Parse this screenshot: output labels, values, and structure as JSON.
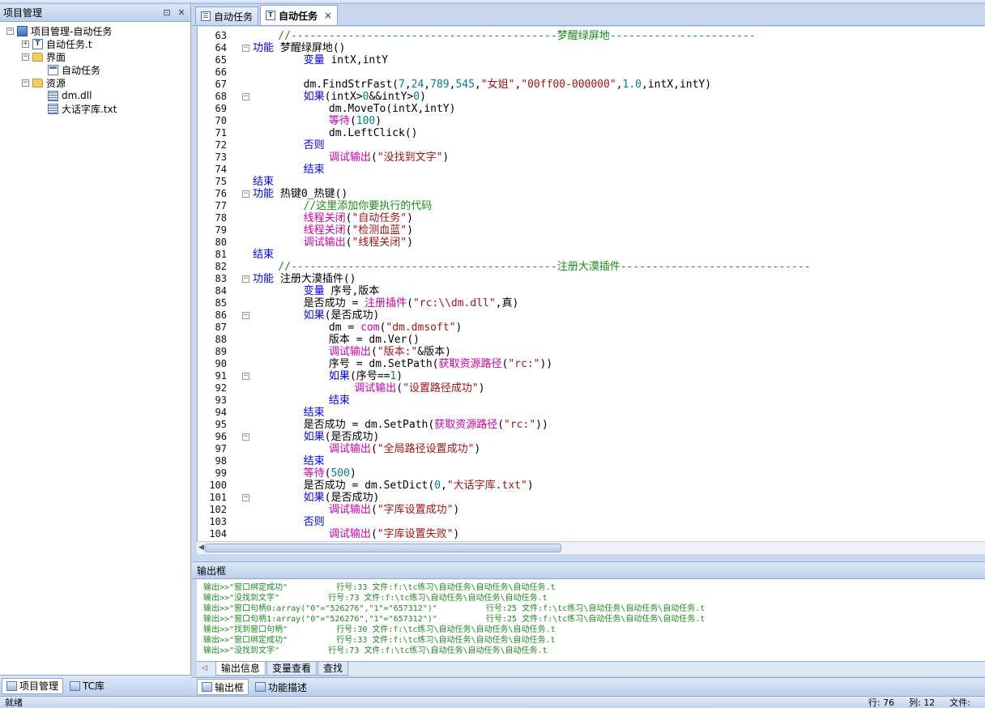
{
  "left_panel": {
    "title": "项目管理",
    "pin_icon": "pin-icon",
    "close_icon": "close-icon",
    "tree": [
      {
        "label": "项目管理-自动任务",
        "level": 0,
        "expander": "⊟",
        "icon": "project"
      },
      {
        "label": "自动任务.t",
        "level": 1,
        "expander": "⊞",
        "icon": "tfile"
      },
      {
        "label": "界面",
        "level": 1,
        "expander": "⊟",
        "icon": "folder"
      },
      {
        "label": "自动任务",
        "level": 2,
        "expander": "",
        "icon": "form"
      },
      {
        "label": "资源",
        "level": 1,
        "expander": "⊟",
        "icon": "folder"
      },
      {
        "label": "dm.dll",
        "level": 2,
        "expander": "",
        "icon": "grid"
      },
      {
        "label": "大话字库.txt",
        "level": 2,
        "expander": "",
        "icon": "grid"
      }
    ],
    "bottom_tabs": [
      "项目管理",
      "TC库"
    ]
  },
  "editor_tabs": [
    {
      "label": "自动任务",
      "active": false
    },
    {
      "label": "自动任务",
      "active": true,
      "close": "×"
    }
  ],
  "code": {
    "first_line": 63,
    "lines": [
      {
        "n": 63,
        "fold": "",
        "segs": [
          [
            "    //------------------------------------------",
            "#1a8a1a"
          ],
          [
            "梦醒绿屏地",
            "#1a8a1a"
          ],
          [
            "-----------------------",
            "#1a8a1a"
          ]
        ]
      },
      {
        "n": 64,
        "fold": "⊟",
        "segs": [
          [
            "功能",
            "#0000ff"
          ],
          [
            " 梦醒绿屏地()",
            "#000000"
          ]
        ]
      },
      {
        "n": 65,
        "fold": "",
        "segs": [
          [
            "        ",
            "#000"
          ],
          [
            "变量",
            "#0000ff"
          ],
          [
            " intX,intY",
            "#000000"
          ]
        ]
      },
      {
        "n": 66,
        "fold": "",
        "segs": [
          [
            "",
            "#000"
          ]
        ]
      },
      {
        "n": 67,
        "fold": "",
        "segs": [
          [
            "        dm.FindStrFast(",
            "#000000"
          ],
          [
            "7",
            "#008080"
          ],
          [
            ",",
            "#000"
          ],
          [
            "24",
            "#008080"
          ],
          [
            ",",
            "#000"
          ],
          [
            "789",
            "#008080"
          ],
          [
            ",",
            "#000"
          ],
          [
            "545",
            "#008080"
          ],
          [
            ",",
            "#000"
          ],
          [
            "\"女姐\"",
            "#a31515"
          ],
          [
            ",",
            "#000"
          ],
          [
            "\"00ff00-000000\"",
            "#a31515"
          ],
          [
            ",",
            "#000"
          ],
          [
            "1.0",
            "#008080"
          ],
          [
            ",intX,intY)",
            "#000000"
          ]
        ]
      },
      {
        "n": 68,
        "fold": "⊟",
        "segs": [
          [
            "        ",
            "#000"
          ],
          [
            "如果",
            "#0000ff"
          ],
          [
            "(intX>",
            "#000000"
          ],
          [
            "0",
            "#008080"
          ],
          [
            "&&intY>",
            "#000000"
          ],
          [
            "0",
            "#008080"
          ],
          [
            ")",
            "#000"
          ]
        ]
      },
      {
        "n": 69,
        "fold": "",
        "segs": [
          [
            "            dm.MoveTo(intX,intY)",
            "#000000"
          ]
        ]
      },
      {
        "n": 70,
        "fold": "",
        "segs": [
          [
            "            ",
            "#000"
          ],
          [
            "等待",
            "#cc00aa"
          ],
          [
            "(",
            "#000"
          ],
          [
            "100",
            "#008080"
          ],
          [
            ")",
            "#000"
          ]
        ]
      },
      {
        "n": 71,
        "fold": "",
        "segs": [
          [
            "            dm.LeftClick()",
            "#000000"
          ]
        ]
      },
      {
        "n": 72,
        "fold": "",
        "segs": [
          [
            "        ",
            "#000"
          ],
          [
            "否则",
            "#0000ff"
          ]
        ]
      },
      {
        "n": 73,
        "fold": "",
        "segs": [
          [
            "            ",
            "#000"
          ],
          [
            "调试输出",
            "#cc00aa"
          ],
          [
            "(",
            "#000"
          ],
          [
            "\"没找到文字\"",
            "#a31515"
          ],
          [
            ")",
            "#000"
          ]
        ]
      },
      {
        "n": 74,
        "fold": "",
        "segs": [
          [
            "        ",
            "#000"
          ],
          [
            "结束",
            "#0000ff"
          ]
        ]
      },
      {
        "n": 75,
        "fold": "",
        "segs": [
          [
            "结束",
            "#0000ff"
          ]
        ]
      },
      {
        "n": 76,
        "fold": "⊟",
        "segs": [
          [
            "功能",
            "#0000ff"
          ],
          [
            " 热键0_热键()",
            "#000000"
          ]
        ]
      },
      {
        "n": 77,
        "fold": "",
        "segs": [
          [
            "        //这里添加你要执行的代码",
            "#1a8a1a"
          ]
        ]
      },
      {
        "n": 78,
        "fold": "",
        "segs": [
          [
            "        ",
            "#000"
          ],
          [
            "线程关闭",
            "#cc00aa"
          ],
          [
            "(",
            "#000"
          ],
          [
            "\"自动任务\"",
            "#a31515"
          ],
          [
            ")",
            "#000"
          ]
        ]
      },
      {
        "n": 79,
        "fold": "",
        "segs": [
          [
            "        ",
            "#000"
          ],
          [
            "线程关闭",
            "#cc00aa"
          ],
          [
            "(",
            "#000"
          ],
          [
            "\"检测血蓝\"",
            "#a31515"
          ],
          [
            ")",
            "#000"
          ]
        ]
      },
      {
        "n": 80,
        "fold": "",
        "segs": [
          [
            "        ",
            "#000"
          ],
          [
            "调试输出",
            "#cc00aa"
          ],
          [
            "(",
            "#000"
          ],
          [
            "\"线程关闭\"",
            "#a31515"
          ],
          [
            ")",
            "#000"
          ]
        ]
      },
      {
        "n": 81,
        "fold": "",
        "segs": [
          [
            "结束",
            "#0000ff"
          ]
        ]
      },
      {
        "n": 82,
        "fold": "",
        "segs": [
          [
            "    //------------------------------------------",
            "#1a8a1a"
          ],
          [
            "注册大漠插件",
            "#1a8a1a"
          ],
          [
            "------------------------------",
            "#1a8a1a"
          ]
        ]
      },
      {
        "n": 83,
        "fold": "⊟",
        "segs": [
          [
            "功能",
            "#0000ff"
          ],
          [
            " 注册大漠插件()",
            "#000000"
          ]
        ]
      },
      {
        "n": 84,
        "fold": "",
        "segs": [
          [
            "        ",
            "#000"
          ],
          [
            "变量",
            "#0000ff"
          ],
          [
            " 序号,版本",
            "#000000"
          ]
        ]
      },
      {
        "n": 85,
        "fold": "",
        "segs": [
          [
            "        是否成功 = ",
            "#000000"
          ],
          [
            "注册插件",
            "#cc00aa"
          ],
          [
            "(",
            "#000"
          ],
          [
            "\"rc:\\\\dm.dll\"",
            "#a31515"
          ],
          [
            ",真)",
            "#000000"
          ]
        ]
      },
      {
        "n": 86,
        "fold": "⊟",
        "segs": [
          [
            "        ",
            "#000"
          ],
          [
            "如果",
            "#0000ff"
          ],
          [
            "(是否成功)",
            "#000000"
          ]
        ]
      },
      {
        "n": 87,
        "fold": "",
        "segs": [
          [
            "            dm = ",
            "#000000"
          ],
          [
            "com",
            "#cc00aa"
          ],
          [
            "(",
            "#000"
          ],
          [
            "\"dm.dmsoft\"",
            "#a31515"
          ],
          [
            ")",
            "#000"
          ]
        ]
      },
      {
        "n": 88,
        "fold": "",
        "segs": [
          [
            "            版本 = dm.Ver()",
            "#000000"
          ]
        ]
      },
      {
        "n": 89,
        "fold": "",
        "segs": [
          [
            "            ",
            "#000"
          ],
          [
            "调试输出",
            "#cc00aa"
          ],
          [
            "(",
            "#000"
          ],
          [
            "\"版本:\"",
            "#a31515"
          ],
          [
            "&版本)",
            "#000000"
          ]
        ]
      },
      {
        "n": 90,
        "fold": "",
        "segs": [
          [
            "            序号 = dm.SetPath(",
            "#000000"
          ],
          [
            "获取资源路径",
            "#cc00aa"
          ],
          [
            "(",
            "#000"
          ],
          [
            "\"rc:\"",
            "#a31515"
          ],
          [
            "))",
            "#000"
          ]
        ]
      },
      {
        "n": 91,
        "fold": "⊟",
        "segs": [
          [
            "            ",
            "#000"
          ],
          [
            "如果",
            "#0000ff"
          ],
          [
            "(序号==",
            "#000000"
          ],
          [
            "1",
            "#008080"
          ],
          [
            ")",
            "#000"
          ]
        ]
      },
      {
        "n": 92,
        "fold": "",
        "segs": [
          [
            "                ",
            "#000"
          ],
          [
            "调试输出",
            "#cc00aa"
          ],
          [
            "(",
            "#000"
          ],
          [
            "\"设置路径成功\"",
            "#a31515"
          ],
          [
            ")",
            "#000"
          ]
        ]
      },
      {
        "n": 93,
        "fold": "",
        "segs": [
          [
            "            ",
            "#000"
          ],
          [
            "结束",
            "#0000ff"
          ]
        ]
      },
      {
        "n": 94,
        "fold": "",
        "segs": [
          [
            "        ",
            "#000"
          ],
          [
            "结束",
            "#0000ff"
          ]
        ]
      },
      {
        "n": 95,
        "fold": "",
        "segs": [
          [
            "        是否成功 = dm.SetPath(",
            "#000000"
          ],
          [
            "获取资源路径",
            "#cc00aa"
          ],
          [
            "(",
            "#000"
          ],
          [
            "\"rc:\"",
            "#a31515"
          ],
          [
            "))",
            "#000"
          ]
        ]
      },
      {
        "n": 96,
        "fold": "⊟",
        "segs": [
          [
            "        ",
            "#000"
          ],
          [
            "如果",
            "#0000ff"
          ],
          [
            "(是否成功)",
            "#000000"
          ]
        ]
      },
      {
        "n": 97,
        "fold": "",
        "segs": [
          [
            "            ",
            "#000"
          ],
          [
            "调试输出",
            "#cc00aa"
          ],
          [
            "(",
            "#000"
          ],
          [
            "\"全局路径设置成功\"",
            "#a31515"
          ],
          [
            ")",
            "#000"
          ]
        ]
      },
      {
        "n": 98,
        "fold": "",
        "segs": [
          [
            "        ",
            "#000"
          ],
          [
            "结束",
            "#0000ff"
          ]
        ]
      },
      {
        "n": 99,
        "fold": "",
        "segs": [
          [
            "        ",
            "#000"
          ],
          [
            "等待",
            "#cc00aa"
          ],
          [
            "(",
            "#000"
          ],
          [
            "500",
            "#008080"
          ],
          [
            ")",
            "#000"
          ]
        ]
      },
      {
        "n": 100,
        "fold": "",
        "segs": [
          [
            "        是否成功 = dm.SetDict(",
            "#000000"
          ],
          [
            "0",
            "#008080"
          ],
          [
            ",",
            "#000"
          ],
          [
            "\"大话字库.txt\"",
            "#a31515"
          ],
          [
            ")",
            "#000"
          ]
        ]
      },
      {
        "n": 101,
        "fold": "⊟",
        "segs": [
          [
            "        ",
            "#000"
          ],
          [
            "如果",
            "#0000ff"
          ],
          [
            "(是否成功)",
            "#000000"
          ]
        ]
      },
      {
        "n": 102,
        "fold": "",
        "segs": [
          [
            "            ",
            "#000"
          ],
          [
            "调试输出",
            "#cc00aa"
          ],
          [
            "(",
            "#000"
          ],
          [
            "\"字库设置成功\"",
            "#a31515"
          ],
          [
            ")",
            "#000"
          ]
        ]
      },
      {
        "n": 103,
        "fold": "",
        "segs": [
          [
            "        ",
            "#000"
          ],
          [
            "否则",
            "#0000ff"
          ]
        ]
      },
      {
        "n": 104,
        "fold": "",
        "segs": [
          [
            "            ",
            "#000"
          ],
          [
            "调试输出",
            "#cc00aa"
          ],
          [
            "(",
            "#000"
          ],
          [
            "\"字库设置失败\"",
            "#a31515"
          ],
          [
            ")",
            "#000"
          ]
        ]
      }
    ]
  },
  "output": {
    "title": "输出框",
    "lines": [
      "输出>>\"窗口绑定成功\"          行号:33 文件:f:\\tc练习\\自动任务\\自动任务\\自动任务.t",
      "输出>>\"没找到文字\"          行号:73 文件:f:\\tc练习\\自动任务\\自动任务\\自动任务.t",
      "输出>>\"窗口句柄0:array(\"0\"=\"526276\",\"1\"=\"657312\")\"          行号:25 文件:f:\\tc练习\\自动任务\\自动任务\\自动任务.t",
      "输出>>\"窗口句柄1:array(\"0\"=\"526276\",\"1\"=\"657312\")\"          行号:25 文件:f:\\tc练习\\自动任务\\自动任务\\自动任务.t",
      "输出>>\"找到窗口句柄\"          行号:30 文件:f:\\tc练习\\自动任务\\自动任务\\自动任务.t",
      "输出>>\"窗口绑定成功\"          行号:33 文件:f:\\tc练习\\自动任务\\自动任务\\自动任务.t",
      "输出>>\"没找到文字\"          行号:73 文件:f:\\tc练习\\自动任务\\自动任务\\自动任务.t"
    ],
    "tabs": [
      "输出信息",
      "变量查看",
      "查找"
    ],
    "bottom_tabs": [
      "输出框",
      "功能描述"
    ]
  },
  "status": {
    "ready": "就绪",
    "line": "行: 76",
    "col": "列: 12",
    "file": "文件:"
  }
}
